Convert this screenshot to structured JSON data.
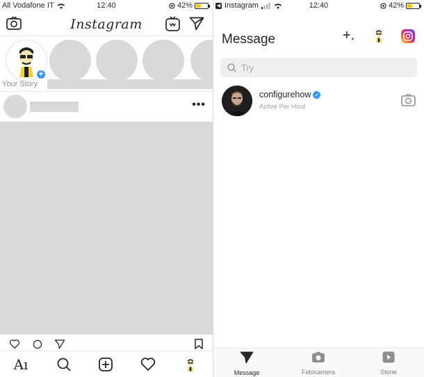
{
  "left": {
    "status": {
      "carrier": "All Vodafone IT",
      "time": "12:40",
      "battery": "42%"
    },
    "header": {
      "logo": "Instagram"
    },
    "stories": {
      "own_label": "Your Story"
    },
    "post": {
      "more": "•••"
    },
    "tabs": [
      "home-tab",
      "search-tab",
      "add-post-tab",
      "activity-tab",
      "profile-tab"
    ],
    "home_glyph": "Aı"
  },
  "right": {
    "status": {
      "app": "Instagram",
      "time": "12:40",
      "battery": "42%"
    },
    "header": {
      "title": "Message",
      "new_message": "+."
    },
    "search": {
      "placeholder": "Try"
    },
    "threads": [
      {
        "name": "configurehow",
        "verified": true,
        "status": "Active Per Hour"
      }
    ],
    "tabbar": [
      {
        "label": "Message",
        "icon": "send-icon",
        "active": true
      },
      {
        "label": "Fotocamera",
        "icon": "camera-icon",
        "active": false
      },
      {
        "label": "Storie",
        "icon": "play-icon",
        "active": false
      }
    ],
    "colors": {
      "accent": "#3897f0",
      "instagram_gradient": [
        "#feda75",
        "#fa7e1e",
        "#d62976",
        "#962fbf",
        "#4f5bd5"
      ]
    }
  }
}
